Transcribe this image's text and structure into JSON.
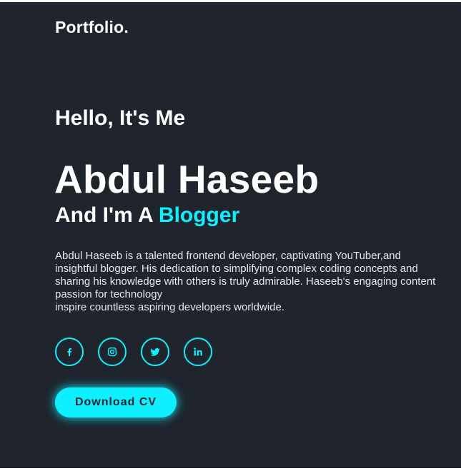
{
  "header": {
    "logo": "Portfolio."
  },
  "hero": {
    "greeting": "Hello, It's Me",
    "name": "Abdul Haseeb",
    "role_prefix": "And I'm A ",
    "role_highlight": "Blogger",
    "bio_lines": [
      "Abdul Haseeb is a talented frontend developer, captivating YouTuber,and",
      "insightful blogger. His dedication to simplifying complex coding concepts and",
      "sharing his knowledge with others is truly admirable. Haseeb's engaging content",
      "passion for technology",
      "inspire countless aspiring developers worldwide."
    ],
    "cta_label": "Download CV"
  },
  "socials": [
    {
      "icon": "facebook-icon"
    },
    {
      "icon": "instagram-icon"
    },
    {
      "icon": "twitter-icon"
    },
    {
      "icon": "linkedin-icon"
    }
  ],
  "colors": {
    "background": "#1f242d",
    "accent": "#0ef0ff",
    "text": "#ffffff"
  }
}
